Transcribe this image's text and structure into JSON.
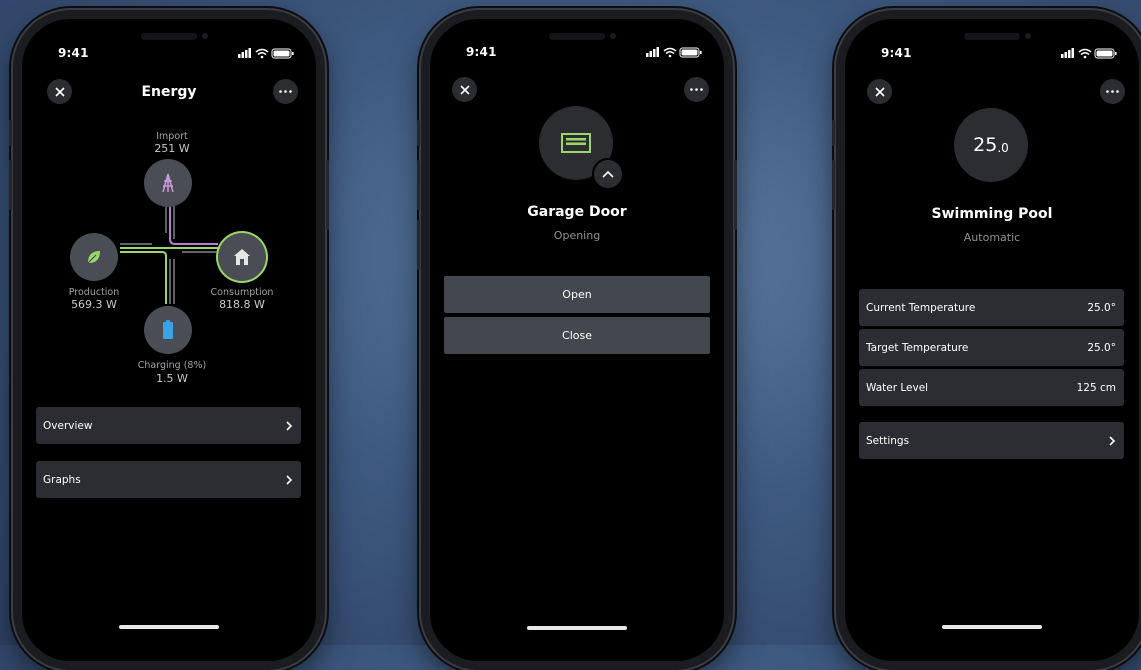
{
  "colors": {
    "accent_green": "#9ad66b",
    "accent_purple": "#b77bd1",
    "battery_blue": "#3aa3e8",
    "row_bg": "#2b2d32",
    "button_bg": "#43484e"
  },
  "status": {
    "time": "9:41"
  },
  "energy": {
    "title": "Energy",
    "import": {
      "label": "Import",
      "value": "251 W"
    },
    "production": {
      "label": "Production",
      "value": "569.3 W"
    },
    "consumption": {
      "label": "Consumption",
      "value": "818.8 W"
    },
    "charging": {
      "label": "Charging (8%)",
      "value": "1.5 W"
    },
    "rows": [
      {
        "label": "Overview"
      },
      {
        "label": "Graphs"
      }
    ]
  },
  "garage": {
    "title": "Garage Door",
    "status": "Opening",
    "buttons": {
      "open": "Open",
      "close": "Close"
    }
  },
  "pool": {
    "temperature_main": "25",
    "temperature_decimal": ".0",
    "title": "Swimming Pool",
    "mode": "Automatic",
    "rows": [
      {
        "label": "Current Temperature",
        "value": "25.0°"
      },
      {
        "label": "Target Temperature",
        "value": "25.0°"
      },
      {
        "label": "Water Level",
        "value": "125 cm"
      }
    ],
    "settings_label": "Settings"
  }
}
